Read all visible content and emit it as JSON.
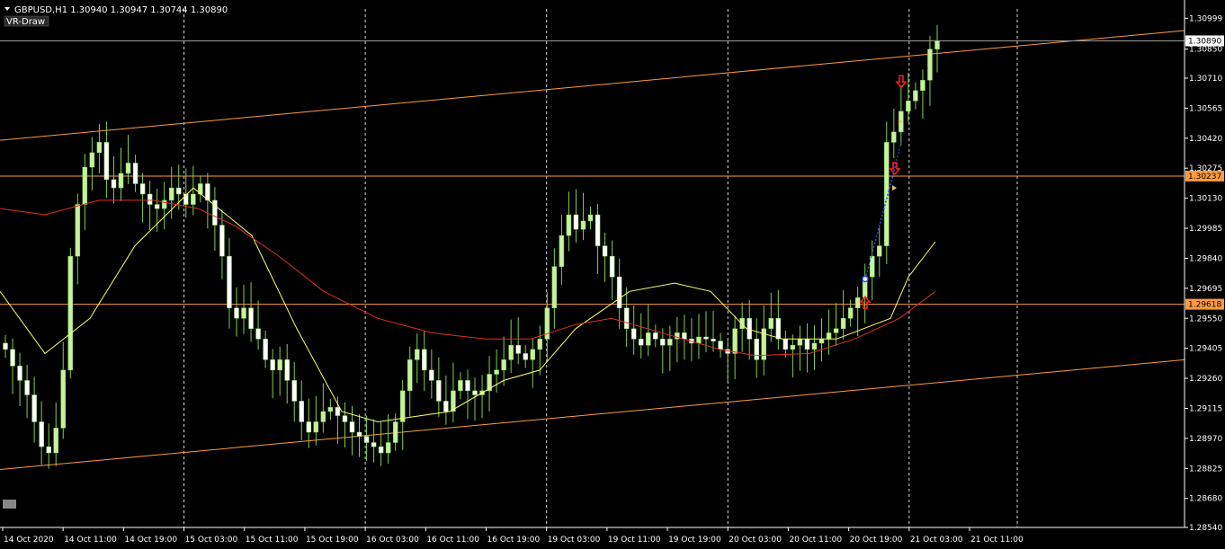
{
  "header": {
    "symbol_line": "GBPUSD,H1  1.30940 1.30947 1.30744 1.30890",
    "indicator_label": "VR-Draw"
  },
  "colors": {
    "background": "#000000",
    "bull_candle": "#c8f0a0",
    "bear_candle": "#ffffff",
    "wick": "#7fd050",
    "ma_fast": "#ffff66",
    "ma_slow": "#e03020",
    "channel": "#ff9a40",
    "hline": "#ff9a40",
    "grid": "#ffffff",
    "arrow_up": "#ff2020",
    "arrow_down": "#ff2020",
    "trend_dotted": "#3050ff"
  },
  "chart_data": {
    "type": "candlestick",
    "symbol": "GBPUSD",
    "timeframe": "H1",
    "ylim": [
      1.2854,
      1.31044
    ],
    "price_ticks": [
      "1.30999",
      "1.30850",
      "1.30710",
      "1.30565",
      "1.30420",
      "1.30275",
      "1.30130",
      "1.29985",
      "1.29840",
      "1.29695",
      "1.29550",
      "1.29405",
      "1.29260",
      "1.29115",
      "1.28970",
      "1.28825",
      "1.28680",
      "1.28540"
    ],
    "time_ticks": [
      "14 Oct 2020",
      "14 Oct 11:00",
      "14 Oct 19:00",
      "15 Oct 03:00",
      "15 Oct 11:00",
      "15 Oct 19:00",
      "16 Oct 03:00",
      "16 Oct 11:00",
      "16 Oct 19:00",
      "19 Oct 03:00",
      "19 Oct 11:00",
      "19 Oct 19:00",
      "20 Oct 03:00",
      "20 Oct 11:00",
      "20 Oct 19:00",
      "21 Oct 03:00",
      "21 Oct 11:00"
    ],
    "current_price": "1.30890",
    "hline_labels": [
      {
        "price": 1.30237,
        "label": "1.30237"
      },
      {
        "price": 1.29618,
        "label": "1.29618"
      }
    ],
    "channel": {
      "upper": [
        [
          0,
          1.3041
        ],
        [
          1317,
          1.3094
        ]
      ],
      "lower": [
        [
          0,
          1.2882
        ],
        [
          1317,
          1.2935
        ]
      ]
    },
    "closes": [
      1.294,
      1.2932,
      1.2925,
      1.2918,
      1.2905,
      1.2893,
      1.289,
      1.2902,
      1.293,
      1.2985,
      1.301,
      1.3028,
      1.3035,
      1.304,
      1.3022,
      1.3018,
      1.3025,
      1.303,
      1.302,
      1.3015,
      1.301,
      1.3008,
      1.3012,
      1.3018,
      1.3015,
      1.301,
      1.3015,
      1.302,
      1.3012,
      1.3,
      1.2985,
      1.296,
      1.2955,
      1.296,
      1.295,
      1.2945,
      1.2935,
      1.293,
      1.2935,
      1.2925,
      1.2915,
      1.2905,
      1.29,
      1.2905,
      1.291,
      1.2912,
      1.2908,
      1.2905,
      1.29,
      1.2898,
      1.2895,
      1.2893,
      1.289,
      1.2895,
      1.2905,
      1.292,
      1.2935,
      1.294,
      1.293,
      1.2925,
      1.2915,
      1.291,
      1.292,
      1.2925,
      1.292,
      1.2918,
      1.292,
      1.2928,
      1.293,
      1.2935,
      1.2942,
      1.2938,
      1.2935,
      1.294,
      1.2945,
      1.296,
      1.298,
      1.2995,
      1.3005,
      1.2998,
      1.3002,
      1.3005,
      1.299,
      1.2985,
      1.2975,
      1.296,
      1.295,
      1.2945,
      1.2942,
      1.2948,
      1.2945,
      1.2942,
      1.2945,
      1.2948,
      1.2945,
      1.2943,
      1.2946,
      1.2945,
      1.2944,
      1.294,
      1.2938,
      1.295,
      1.2955,
      1.2945,
      1.2935,
      1.295,
      1.2955,
      1.2945,
      1.294,
      1.2942,
      1.2945,
      1.294,
      1.2943,
      1.2945,
      1.2948,
      1.295,
      1.2955,
      1.296,
      1.2965,
      1.2975,
      1.2985,
      1.299,
      1.304,
      1.3045,
      1.3055,
      1.306,
      1.3065,
      1.307,
      1.3085,
      1.3089
    ]
  },
  "chart_points": {
    "ma_fast": [
      [
        1.2968,
        0
      ],
      [
        1.2938,
        50
      ],
      [
        1.2955,
        100
      ],
      [
        1.299,
        150
      ],
      [
        1.3018,
        215
      ],
      [
        1.2995,
        280
      ],
      [
        1.295,
        330
      ],
      [
        1.291,
        380
      ],
      [
        1.2905,
        420
      ],
      [
        1.291,
        500
      ],
      [
        1.2925,
        560
      ],
      [
        1.293,
        600
      ],
      [
        1.295,
        640
      ],
      [
        1.2968,
        700
      ],
      [
        1.2972,
        750
      ],
      [
        1.2968,
        790
      ],
      [
        1.295,
        830
      ],
      [
        1.2945,
        870
      ],
      [
        1.2945,
        930
      ],
      [
        1.2955,
        990
      ],
      [
        1.2975,
        1010
      ],
      [
        1.2992,
        1040
      ]
    ],
    "ma_slow": [
      [
        1.3008,
        0
      ],
      [
        1.3005,
        50
      ],
      [
        1.3012,
        110
      ],
      [
        1.3012,
        170
      ],
      [
        1.3008,
        220
      ],
      [
        1.3,
        260
      ],
      [
        1.2985,
        310
      ],
      [
        1.2968,
        360
      ],
      [
        1.2955,
        420
      ],
      [
        1.2948,
        480
      ],
      [
        1.2945,
        540
      ],
      [
        1.2945,
        590
      ],
      [
        1.2952,
        640
      ],
      [
        1.2955,
        680
      ],
      [
        1.295,
        720
      ],
      [
        1.2945,
        760
      ],
      [
        1.294,
        800
      ],
      [
        1.2937,
        840
      ],
      [
        1.2938,
        900
      ],
      [
        1.2945,
        950
      ],
      [
        1.2955,
        1000
      ],
      [
        1.2968,
        1040
      ]
    ]
  }
}
